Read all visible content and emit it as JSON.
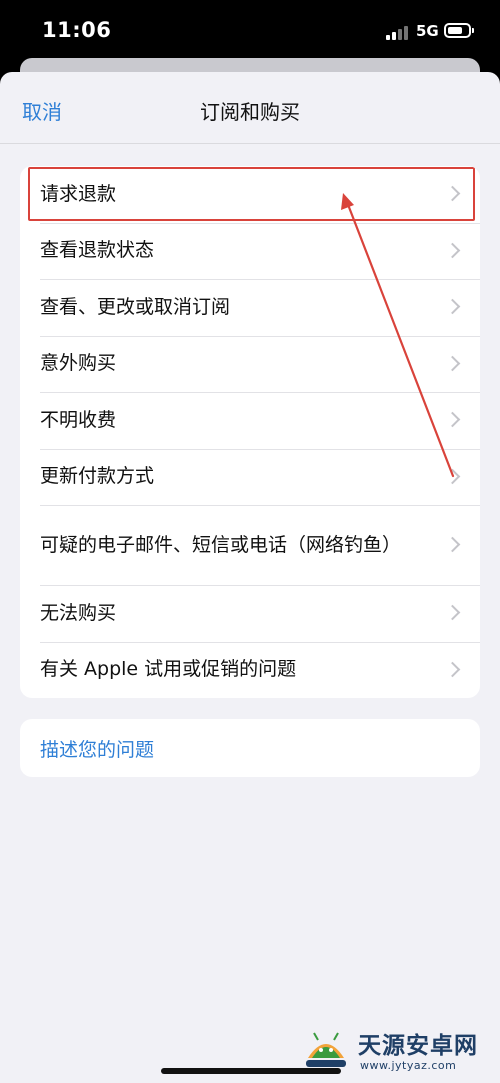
{
  "status_bar": {
    "time": "11:06",
    "network": "5G",
    "icons": [
      "signal-icon",
      "battery-icon"
    ]
  },
  "nav": {
    "cancel_label": "取消",
    "title": "订阅和购买"
  },
  "menu": {
    "items": [
      {
        "label": "请求退款",
        "highlighted": true
      },
      {
        "label": "查看退款状态"
      },
      {
        "label": "查看、更改或取消订阅"
      },
      {
        "label": "意外购买"
      },
      {
        "label": "不明收费"
      },
      {
        "label": "更新付款方式"
      },
      {
        "label": "可疑的电子邮件、短信或电话（网络钓鱼）"
      },
      {
        "label": "无法购买"
      },
      {
        "label": "有关 Apple 试用或促销的问题"
      }
    ]
  },
  "describe_link": {
    "label": "描述您的问题"
  },
  "watermark": {
    "title": "天源安卓网",
    "url": "www.jytyaz.com"
  },
  "colors": {
    "accent": "#2f7fd6",
    "annotation": "#d9433b",
    "background": "#f1f1f6",
    "watermark": "#1f3f66"
  }
}
